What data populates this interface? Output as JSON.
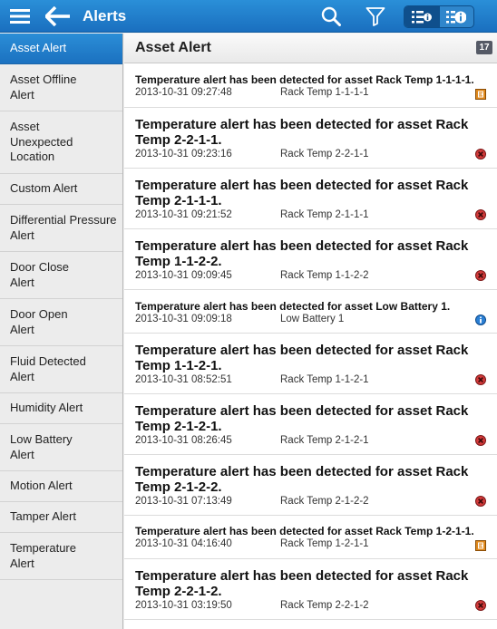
{
  "header": {
    "title": "Alerts",
    "icons": [
      "menu-icon",
      "back-arrow-icon",
      "search-icon",
      "filter-icon",
      "list-detail-icon",
      "info-list-icon"
    ]
  },
  "colors": {
    "topbar": "#1a7ccb",
    "active_item": "#1f78c8",
    "critical": "#d23a3a",
    "warning": "#d9881b",
    "info": "#2a7fd4"
  },
  "sidebar": {
    "items": [
      {
        "label": "Asset Alert",
        "active": true
      },
      {
        "label": "Asset Offline Alert",
        "active": false
      },
      {
        "label": "Asset Unexpected Location",
        "active": false
      },
      {
        "label": "Custom Alert",
        "active": false
      },
      {
        "label": "Differential Pressure Alert",
        "active": false
      },
      {
        "label": "Door Close Alert",
        "active": false
      },
      {
        "label": "Door Open Alert",
        "active": false
      },
      {
        "label": "Fluid Detected Alert",
        "active": false
      },
      {
        "label": "Humidity Alert",
        "active": false
      },
      {
        "label": "Low Battery Alert",
        "active": false
      },
      {
        "label": "Motion Alert",
        "active": false
      },
      {
        "label": "Tamper Alert",
        "active": false
      },
      {
        "label": "Temperature Alert",
        "active": false
      }
    ]
  },
  "main": {
    "title": "Asset Alert",
    "count": "17",
    "alerts": [
      {
        "message": "Temperature alert has been detected for asset Rack Temp 1-1-1-1.",
        "time": "2013-10-31 09:27:48",
        "asset": "Rack Temp 1-1-1-1",
        "severity": "warning"
      },
      {
        "message": "Temperature alert has been detected for asset Rack Temp 2-2-1-1.",
        "time": "2013-10-31 09:23:16",
        "asset": "Rack Temp 2-2-1-1",
        "severity": "critical"
      },
      {
        "message": "Temperature alert has been detected for asset Rack Temp 2-1-1-1.",
        "time": "2013-10-31 09:21:52",
        "asset": "Rack Temp 2-1-1-1",
        "severity": "critical"
      },
      {
        "message": "Temperature alert has been detected for asset Rack Temp 1-1-2-2.",
        "time": "2013-10-31 09:09:45",
        "asset": "Rack Temp 1-1-2-2",
        "severity": "critical"
      },
      {
        "message": "Temperature alert has been detected for asset Low Battery 1.",
        "time": "2013-10-31 09:09:18",
        "asset": "Low Battery 1",
        "severity": "info"
      },
      {
        "message": "Temperature alert has been detected for asset Rack Temp 1-1-2-1.",
        "time": "2013-10-31 08:52:51",
        "asset": "Rack Temp 1-1-2-1",
        "severity": "critical"
      },
      {
        "message": "Temperature alert has been detected for asset Rack Temp 2-1-2-1.",
        "time": "2013-10-31 08:26:45",
        "asset": "Rack Temp 2-1-2-1",
        "severity": "critical"
      },
      {
        "message": "Temperature alert has been detected for asset Rack Temp 2-1-2-2.",
        "time": "2013-10-31 07:13:49",
        "asset": "Rack Temp 2-1-2-2",
        "severity": "critical"
      },
      {
        "message": "Temperature alert has been detected for asset Rack Temp 1-2-1-1.",
        "time": "2013-10-31 04:16:40",
        "asset": "Rack Temp 1-2-1-1",
        "severity": "warning"
      },
      {
        "message": "Temperature alert has been detected for asset Rack Temp 2-2-1-2.",
        "time": "2013-10-31 03:19:50",
        "asset": "Rack Temp 2-2-1-2",
        "severity": "critical"
      }
    ]
  }
}
